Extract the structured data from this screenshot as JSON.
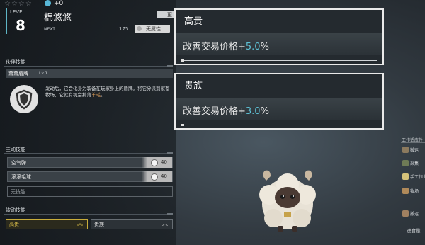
{
  "header": {
    "stars": "☆☆☆☆",
    "gem_bonus": "+0",
    "level_label": "LEVEL",
    "level": "8",
    "pal_name": "棉悠悠",
    "next_label": "NEXT",
    "next_value": "175",
    "element": "无属性",
    "top_tab": "更"
  },
  "partner_skill": {
    "section_title": "伙伴技能",
    "name": "茸茸盾牌",
    "level": "Lv.1",
    "icon": "shield-icon",
    "desc_part1": "发动后，它会化身为装备在玩家身上的盾牌。将它分派到家畜牧场，它就有机会掉落",
    "desc_highlight": "羊毛",
    "desc_part2": "。"
  },
  "active_skills": {
    "section_title": "主动技能",
    "items": [
      {
        "name": "空气弹",
        "cost": "40"
      },
      {
        "name": "滚滚毛球",
        "cost": "40"
      }
    ],
    "empty_label": "无技能"
  },
  "passive_skills": {
    "section_title": "被动技能",
    "items": [
      {
        "name": "高贵"
      },
      {
        "name": "贵族"
      }
    ]
  },
  "tooltips": [
    {
      "title": "高贵",
      "text_prefix": "改善交易价格+",
      "value": "5.0",
      "suffix": "%"
    },
    {
      "title": "贵族",
      "text_prefix": "改善交易价格+",
      "value": "3.0",
      "suffix": "%"
    }
  ],
  "right_panel": {
    "title": "工作适应性",
    "items": [
      {
        "label": "搬运"
      },
      {
        "label": "采集"
      },
      {
        "label": "手工作业"
      },
      {
        "label": "牧场"
      },
      {
        "label": "搬运"
      }
    ],
    "food_label": "进食量"
  },
  "colors": {
    "accent_blue": "#5ec1d5",
    "passive_gold": "#c9ad3b",
    "highlight_orange": "#e7a35b"
  }
}
